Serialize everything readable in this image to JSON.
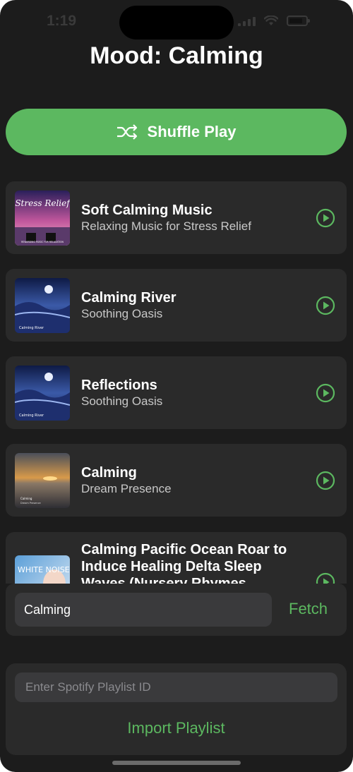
{
  "status": {
    "time": "1:19"
  },
  "header": {
    "title": "Mood: Calming"
  },
  "shuffle": {
    "label": "Shuffle Play",
    "icon": "shuffle-icon"
  },
  "tracks": [
    {
      "title": "Soft Calming Music",
      "artist": "Relaxing Music for Stress Relief",
      "art_text": "Stress Relief",
      "art_caption": "REWARDING MUSIC FOR RELAXATION"
    },
    {
      "title": "Calming River",
      "artist": "Soothing Oasis",
      "art_text": "Calming River",
      "art_caption": "Soothing Oasis"
    },
    {
      "title": "Reflections",
      "artist": "Soothing Oasis",
      "art_text": "Calming River",
      "art_caption": "Soothing Oasis"
    },
    {
      "title": "Calming",
      "artist": "Dream Presence",
      "art_text": "Calming",
      "art_caption": "Dream Presence"
    },
    {
      "title": "Calming Pacific Ocean Roar to Induce Healing Delta Sleep Waves (Nursery Rhymes",
      "artist": "",
      "art_text": "WHITE NOISE",
      "art_caption": ""
    }
  ],
  "fetch": {
    "input_value": "Calming",
    "button_label": "Fetch"
  },
  "import": {
    "placeholder": "Enter Spotify Playlist ID",
    "button_label": "Import Playlist"
  },
  "colors": {
    "background": "#1c1c1c",
    "card": "#2a2a2a",
    "accent": "#5cb860",
    "input": "#3a3a3c"
  }
}
